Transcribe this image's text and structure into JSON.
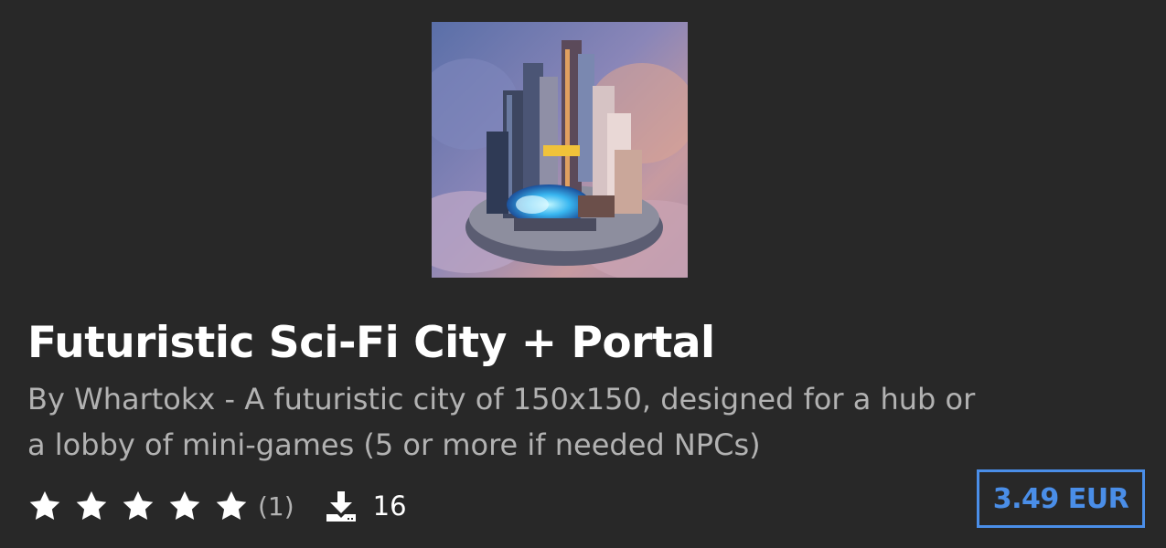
{
  "product": {
    "title": "Futuristic Sci-Fi City + Portal",
    "description": "By Whartokx - A futuristic city of 150x150, designed for a hub or a lobby of mini-games (5 or more if needed NPCs)",
    "thumbnail_icon": "futuristic-city-thumbnail",
    "rating": {
      "stars": 5,
      "max_stars": 5,
      "count_label": "(1)"
    },
    "downloads": {
      "icon": "download-icon",
      "count": "16"
    },
    "price": "3.49 EUR"
  },
  "colors": {
    "background": "#282828",
    "title": "#ffffff",
    "description": "#b2b2b2",
    "accent": "#4a8ee8"
  }
}
